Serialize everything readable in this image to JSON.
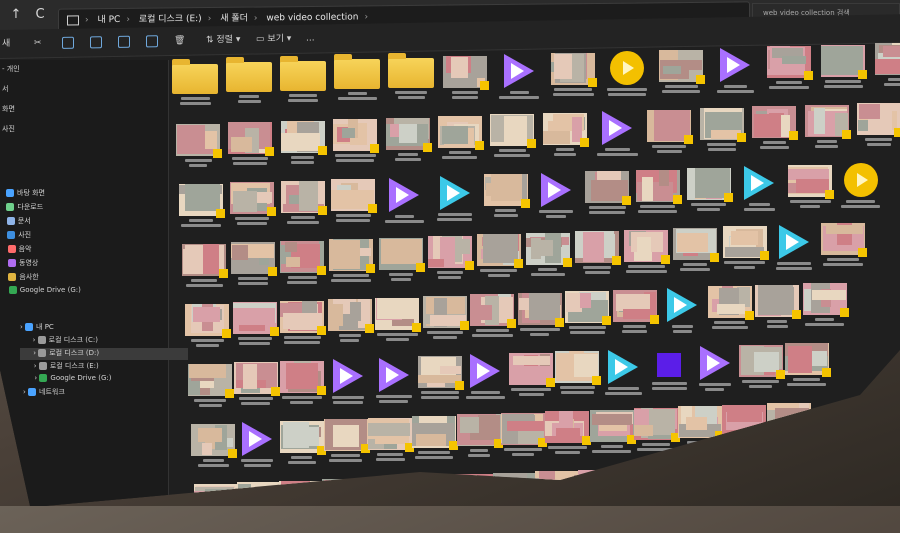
{
  "titlebar": {
    "nav_glyph": "↑",
    "refresh_glyph": "C",
    "breadcrumb": [
      "내 PC",
      "로컬 디스크 (E:)",
      "새 폴더",
      "web video collection"
    ],
    "search_placeholder": "web video collection 검색"
  },
  "toolbar": {
    "new_label": "새",
    "sort_label": "정렬",
    "view_label": "보기",
    "more_label": "..."
  },
  "sidebar": {
    "top_items": [
      "- 개인",
      "서",
      "화면",
      "사진"
    ],
    "quick_items": [
      {
        "label": "바탕 화면",
        "icon": "desktop-icon",
        "color": "#4aa3ff"
      },
      {
        "label": "다운로드",
        "icon": "download-icon",
        "color": "#6fd08c"
      },
      {
        "label": "문서",
        "icon": "document-icon",
        "color": "#8fb4e8"
      },
      {
        "label": "사진",
        "icon": "picture-icon",
        "color": "#3d8fe0"
      },
      {
        "label": "음악",
        "icon": "music-icon",
        "color": "#ff6b6b"
      },
      {
        "label": "동영상",
        "icon": "video-icon",
        "color": "#b06cf0"
      },
      {
        "label": "음사한",
        "icon": "folder-icon",
        "color": "#e0b440"
      },
      {
        "label": "Google Drive (G:)",
        "icon": "google-drive-icon",
        "color": "#34a853"
      }
    ],
    "tree_items": [
      {
        "label": "내 PC",
        "icon": "pc-icon",
        "color": "#4aa3ff"
      },
      {
        "label": "로컬 디스크 (C:)",
        "icon": "drive-icon",
        "color": "#9a9a9a"
      },
      {
        "label": "로컬 디스크 (D:)",
        "icon": "drive-icon",
        "color": "#9a9a9a"
      },
      {
        "label": "로컬 디스크 (E:)",
        "icon": "drive-icon",
        "color": "#9a9a9a"
      },
      {
        "label": "Google Drive (G:)",
        "icon": "google-drive-icon",
        "color": "#34a853"
      },
      {
        "label": "네트워크",
        "icon": "network-icon",
        "color": "#4aa3ff"
      }
    ]
  },
  "colors": {
    "accent": "#f5c400",
    "play_purple": "#a970ff",
    "play_cyan": "#3cc9e8",
    "dark_bg": "#1f1f1f"
  }
}
